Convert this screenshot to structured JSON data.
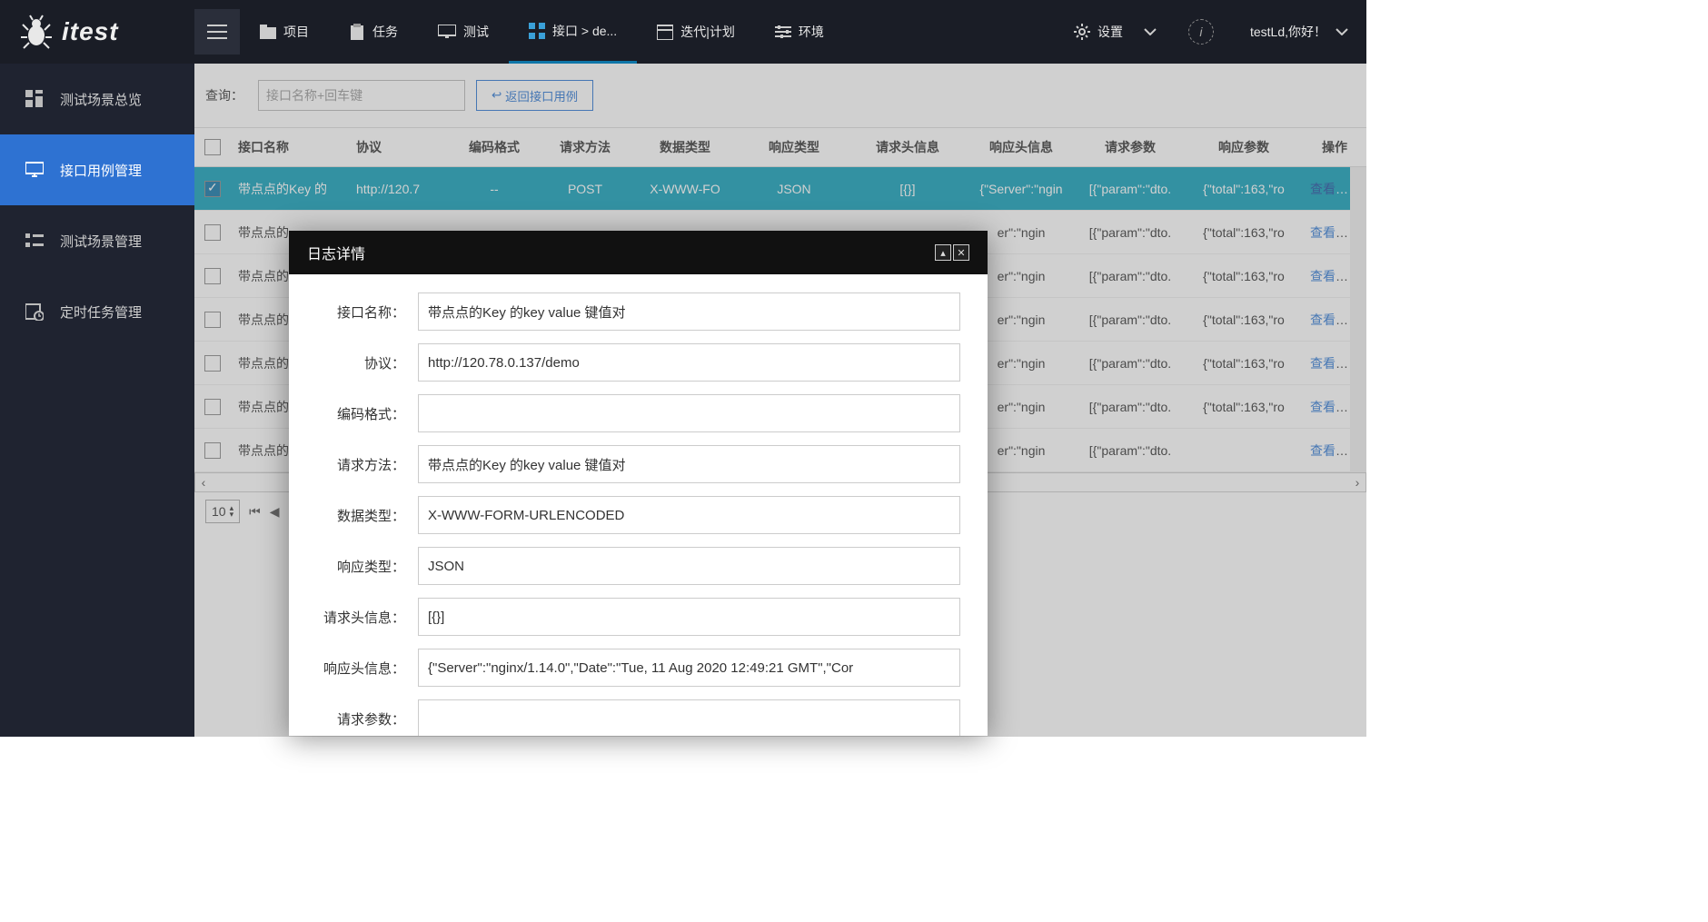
{
  "app": {
    "name": "itest"
  },
  "topnav": {
    "items": [
      {
        "label": "项目"
      },
      {
        "label": "任务"
      },
      {
        "label": "测试"
      },
      {
        "label": "接口 > de..."
      },
      {
        "label": "迭代|计划"
      },
      {
        "label": "环境"
      }
    ],
    "settings_label": "设置",
    "user_greeting": "testLd,你好！"
  },
  "sidebar": {
    "items": [
      {
        "label": "测试场景总览"
      },
      {
        "label": "接口用例管理"
      },
      {
        "label": "测试场景管理"
      },
      {
        "label": "定时任务管理"
      }
    ]
  },
  "toolbar": {
    "query_label": "查询：",
    "search_placeholder": "接口名称+回车键",
    "return_label": "返回接口用例"
  },
  "grid": {
    "headers": {
      "name": "接口名称",
      "proto": "协议",
      "enc": "编码格式",
      "method": "请求方法",
      "dtype": "数据类型",
      "rtype": "响应类型",
      "reqh": "请求头信息",
      "resh": "响应头信息",
      "reqp": "请求参数",
      "resp": "响应参数",
      "op": "操作"
    },
    "rows": [
      {
        "checked": true,
        "name": "带点点的Key 的",
        "proto": "http://120.7",
        "enc": "--",
        "method": "POST",
        "dtype": "X-WWW-FO",
        "rtype": "JSON",
        "reqh": "[{}]",
        "resh": "{\"Server\":\"ngin",
        "reqp": "[{\"param\":\"dto.",
        "resp": "{\"total\":163,\"ro",
        "op": "查看详情"
      },
      {
        "checked": false,
        "name": "带点点的",
        "proto": "",
        "enc": "",
        "method": "",
        "dtype": "",
        "rtype": "",
        "reqh": "",
        "resh": "er\":\"ngin",
        "reqp": "[{\"param\":\"dto.",
        "resp": "{\"total\":163,\"ro",
        "op": "查看详情"
      },
      {
        "checked": false,
        "name": "带点点的",
        "proto": "",
        "enc": "",
        "method": "",
        "dtype": "",
        "rtype": "",
        "reqh": "",
        "resh": "er\":\"ngin",
        "reqp": "[{\"param\":\"dto.",
        "resp": "{\"total\":163,\"ro",
        "op": "查看详情"
      },
      {
        "checked": false,
        "name": "带点点的",
        "proto": "",
        "enc": "",
        "method": "",
        "dtype": "",
        "rtype": "",
        "reqh": "",
        "resh": "er\":\"ngin",
        "reqp": "[{\"param\":\"dto.",
        "resp": "{\"total\":163,\"ro",
        "op": "查看详情"
      },
      {
        "checked": false,
        "name": "带点点的",
        "proto": "",
        "enc": "",
        "method": "",
        "dtype": "",
        "rtype": "",
        "reqh": "",
        "resh": "er\":\"ngin",
        "reqp": "[{\"param\":\"dto.",
        "resp": "{\"total\":163,\"ro",
        "op": "查看详情"
      },
      {
        "checked": false,
        "name": "带点点的",
        "proto": "",
        "enc": "",
        "method": "",
        "dtype": "",
        "rtype": "",
        "reqh": "",
        "resh": "er\":\"ngin",
        "reqp": "[{\"param\":\"dto.",
        "resp": "{\"total\":163,\"ro",
        "op": "查看详情"
      },
      {
        "checked": false,
        "name": "带点点的",
        "proto": "",
        "enc": "",
        "method": "",
        "dtype": "",
        "rtype": "",
        "reqh": "",
        "resh": "er\":\"ngin",
        "reqp": "[{\"param\":\"dto.",
        "resp": "",
        "op": "查看详情"
      }
    ]
  },
  "pager": {
    "pagesize": "10"
  },
  "dialog": {
    "title": "日志详情",
    "fields": [
      {
        "label": "接口名称：",
        "value": "带点点的Key 的key value 键值对"
      },
      {
        "label": "协议：",
        "value": "http://120.78.0.137/demo"
      },
      {
        "label": "编码格式：",
        "value": ""
      },
      {
        "label": "请求方法：",
        "value": "带点点的Key 的key value 键值对"
      },
      {
        "label": "数据类型：",
        "value": "X-WWW-FORM-URLENCODED"
      },
      {
        "label": "响应类型：",
        "value": "JSON"
      },
      {
        "label": "请求头信息：",
        "value": "[{}]"
      },
      {
        "label": "响应头信息：",
        "value": "{\"Server\":\"nginx/1.14.0\",\"Date\":\"Tue, 11 Aug 2020 12:49:21 GMT\",\"Cor"
      },
      {
        "label": "请求参数：",
        "value": ""
      }
    ]
  }
}
